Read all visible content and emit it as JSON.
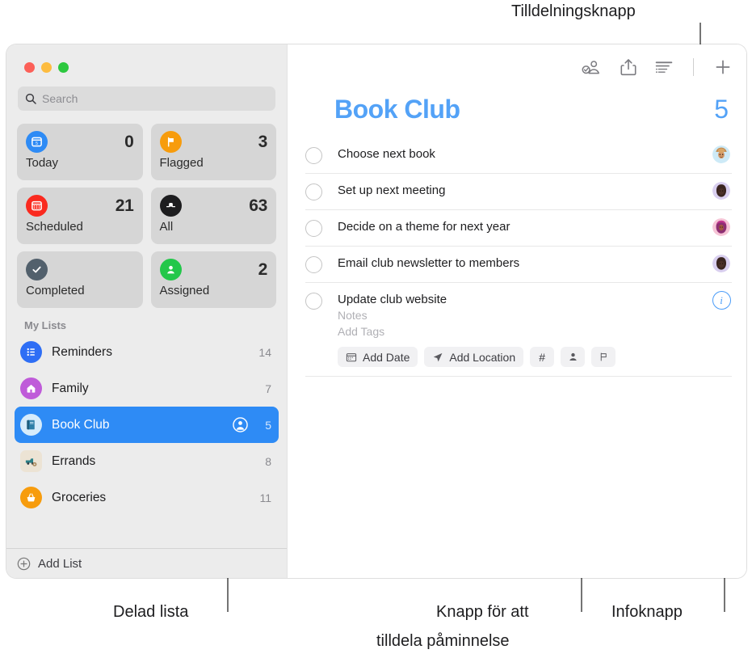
{
  "annotations": [
    {
      "id": "assign-toolbar",
      "text": "Tilldelningsknapp"
    },
    {
      "id": "shared-list",
      "text": "Delad lista"
    },
    {
      "id": "assign-reminder",
      "text": "Knapp för att"
    },
    {
      "id": "assign-reminder-2",
      "text": "tilldela påminnelse"
    },
    {
      "id": "info-button",
      "text": "Infoknapp"
    }
  ],
  "window": {
    "traffic_lights": {
      "close": "close-button",
      "minimize": "minimize-button",
      "zoom": "zoom-button"
    }
  },
  "sidebar": {
    "search": {
      "placeholder": "Search",
      "value": "",
      "icon": "search-icon"
    },
    "smart_lists": [
      {
        "label": "Today",
        "count": "0",
        "icon": "calendar-today-icon",
        "color": "#2e8bf5"
      },
      {
        "label": "Flagged",
        "count": "3",
        "icon": "flag-icon",
        "color": "#f79c0d"
      },
      {
        "label": "Scheduled",
        "count": "21",
        "icon": "calendar-icon",
        "color": "#fa2a1f"
      },
      {
        "label": "All",
        "count": "63",
        "icon": "inbox-tray-icon",
        "color": "#3a3a3c"
      },
      {
        "label": "Completed",
        "count": "",
        "icon": "checkmark-icon",
        "color": "#52606c"
      },
      {
        "label": "Assigned",
        "count": "2",
        "icon": "person-icon",
        "color": "#23c74a"
      }
    ],
    "my_lists_header": "My Lists",
    "lists": [
      {
        "label": "Reminders",
        "count": "14",
        "icon": "bullet-list-icon",
        "color": "#2e6ef5",
        "selected": false,
        "shared": false
      },
      {
        "label": "Family",
        "count": "7",
        "icon": "house-icon",
        "color": "#bf5bd9",
        "selected": false,
        "shared": false
      },
      {
        "label": "Book Club",
        "count": "5",
        "icon": "book-icon",
        "color": "#d6ecfb",
        "selected": true,
        "shared": true
      },
      {
        "label": "Errands",
        "count": "8",
        "icon": "truck-icon",
        "color": "#ece3d4",
        "selected": false,
        "shared": false
      },
      {
        "label": "Groceries",
        "count": "11",
        "icon": "basket-icon",
        "color": "#f79c0d",
        "selected": false,
        "shared": false
      }
    ],
    "add_list": {
      "label": "Add List",
      "icon": "plus-circle-icon"
    }
  },
  "main": {
    "toolbar": [
      {
        "name": "assign-toolbar-button",
        "icon": "person-check-icon"
      },
      {
        "name": "share-button",
        "icon": "share-icon"
      },
      {
        "name": "view-options-button",
        "icon": "list-options-icon"
      },
      {
        "name": "add-reminder-button",
        "icon": "plus-icon"
      }
    ],
    "title": "Book Club",
    "count": "5",
    "accent_color": "#53a2f7",
    "reminders": [
      {
        "title": "Choose next book",
        "avatar": "avatar-hat-person",
        "expanded": false
      },
      {
        "title": "Set up next meeting",
        "avatar": "avatar-dark-person",
        "expanded": false
      },
      {
        "title": "Decide on a theme for next year",
        "avatar": "avatar-pink-person",
        "expanded": false
      },
      {
        "title": "Email club newsletter to members",
        "avatar": "avatar-dark-person",
        "expanded": false
      },
      {
        "title": "Update club website",
        "avatar": "info-button",
        "expanded": true
      }
    ],
    "expanded_detail": {
      "notes_placeholder": "Notes",
      "tags_placeholder": "Add Tags",
      "buttons": [
        {
          "label": "Add Date",
          "icon": "calendar-small-icon"
        },
        {
          "label": "Add Location",
          "icon": "location-arrow-icon"
        },
        {
          "label": "#",
          "icon": "hash-icon"
        },
        {
          "label": "",
          "icon": "person-small-icon"
        },
        {
          "label": "",
          "icon": "flag-outline-icon"
        }
      ]
    }
  }
}
